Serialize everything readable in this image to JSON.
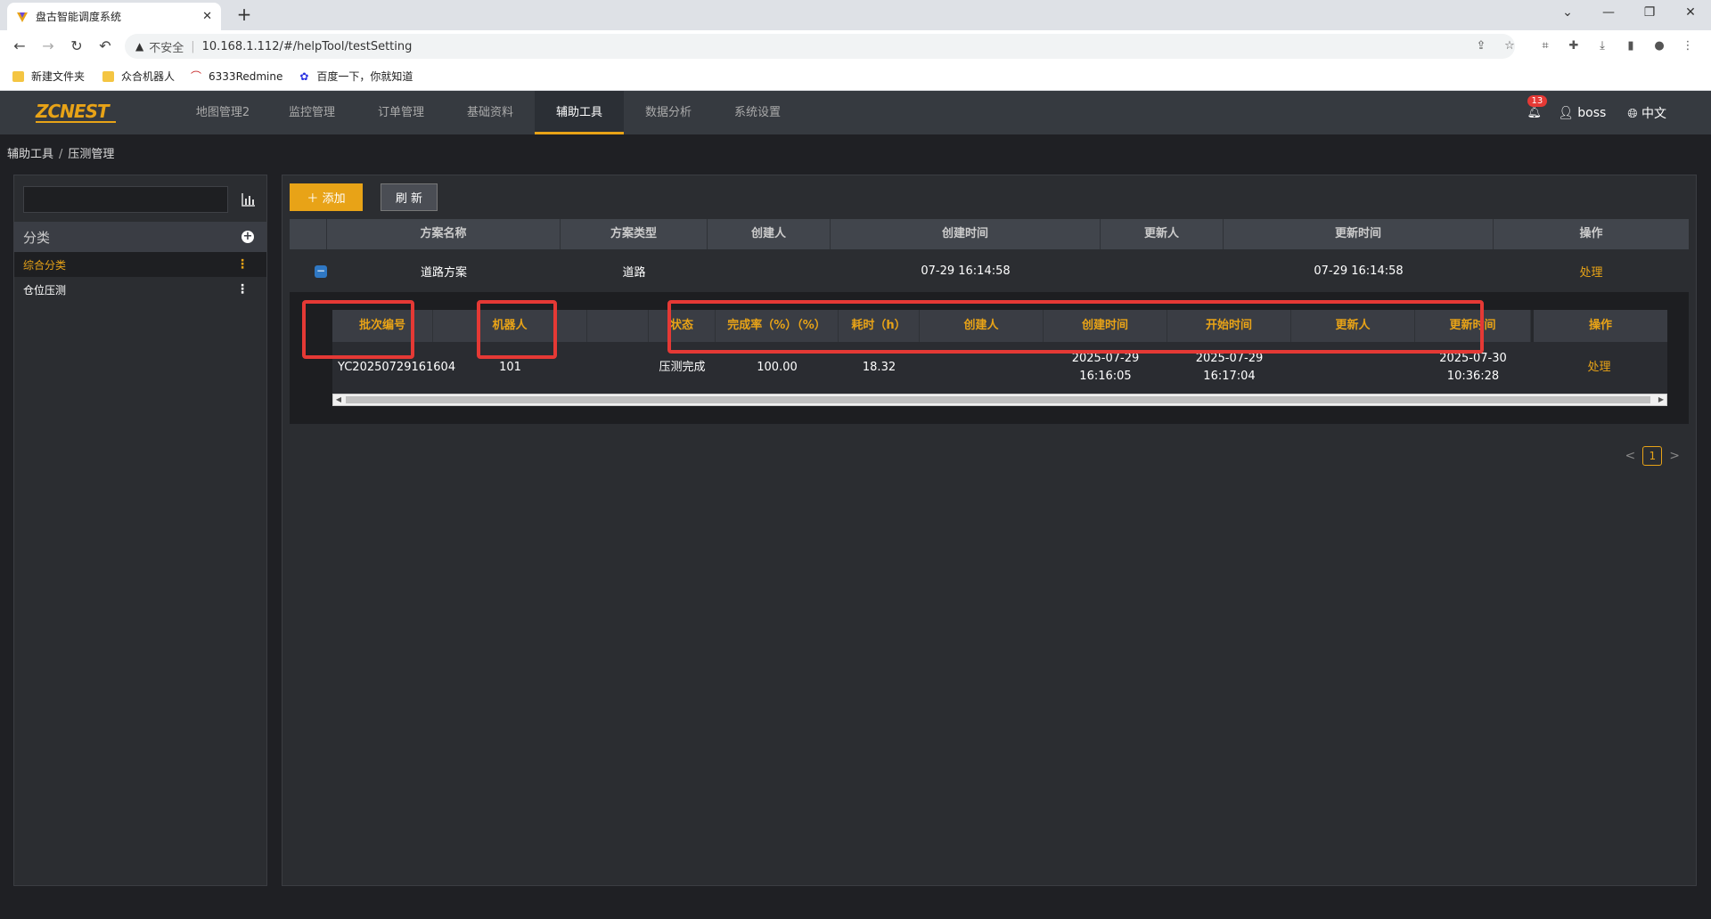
{
  "browser": {
    "tab_title": "盘古智能调度系统",
    "insecure_label": "不安全",
    "url": "10.168.1.112/#/helpTool/testSetting",
    "bookmarks": [
      "新建文件夹",
      "众合机器人",
      "6333Redmine",
      "百度一下，你就知道"
    ]
  },
  "app": {
    "logo": "ZCNEST",
    "nav": [
      "地图管理2",
      "监控管理",
      "订单管理",
      "基础资料",
      "辅助工具",
      "数据分析",
      "系统设置"
    ],
    "active_nav": "辅助工具",
    "notification_count": "13",
    "user": "boss",
    "language": "中文"
  },
  "breadcrumb": [
    "辅助工具",
    "压测管理"
  ],
  "sidebar": {
    "search_placeholder": "",
    "category_title": "分类",
    "items": [
      {
        "label": "综合分类",
        "selected": true
      },
      {
        "label": "仓位压测",
        "selected": false
      }
    ]
  },
  "toolbar": {
    "add_label": "添加",
    "refresh_label": "刷 新"
  },
  "outer_table": {
    "headers": [
      "方案名称",
      "方案类型",
      "创建人",
      "创建时间",
      "更新人",
      "更新时间",
      "操作"
    ],
    "rows": [
      {
        "name": "道路方案",
        "type": "道路",
        "creator": "",
        "created": "07-29 16:14:58",
        "updater": "",
        "updated": "07-29 16:14:58",
        "action": "处理"
      }
    ]
  },
  "inner_table": {
    "headers": [
      "批次编号",
      "机器人",
      "",
      "状态",
      "完成率（%）（%）",
      "耗时（h）",
      "创建人",
      "创建时间",
      "开始时间",
      "更新人",
      "更新时间",
      "操作"
    ],
    "rows": [
      {
        "batch": "YC20250729161604",
        "robot": "101",
        "blank": "",
        "status": "压测完成",
        "rate": "100.00",
        "duration": "18.32",
        "creator": "",
        "created_date": "2025-07-29",
        "created_time": "16:16:05",
        "start_date": "2025-07-29",
        "start_time": "16:17:04",
        "updater": "",
        "updated_date": "2025-07-30",
        "updated_time": "10:36:28",
        "action": "处理"
      }
    ]
  },
  "pagination": {
    "current": "1",
    "prev": "<",
    "next": ">"
  }
}
